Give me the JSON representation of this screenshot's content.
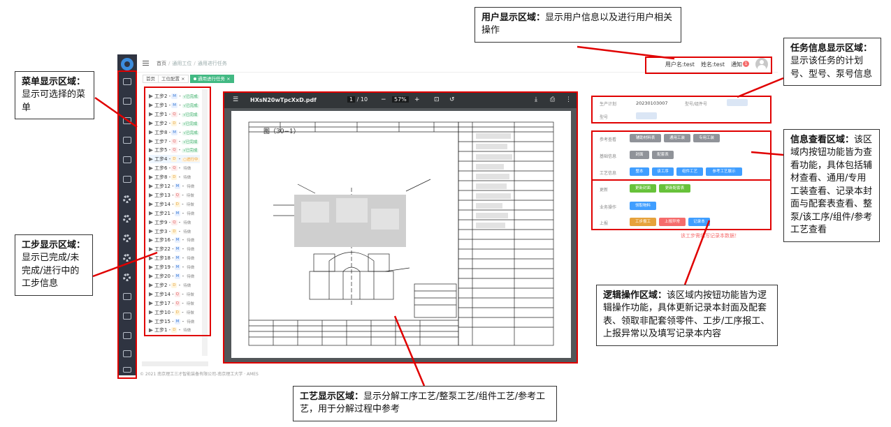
{
  "app": {
    "breadcrumb": [
      "首页",
      "通用工位",
      "通用进行任务"
    ],
    "user": {
      "username_label": "用户名:test",
      "name_label": "姓名:test",
      "notify_label": "通知",
      "notify_count": "1"
    },
    "tabs": [
      {
        "label": "首页"
      },
      {
        "label": "工位配置 ×"
      },
      {
        "label": "通用进行任务 ×",
        "active": true
      }
    ],
    "steps": [
      {
        "name": "工步2 -",
        "tag": "M",
        "status": "√已完成"
      },
      {
        "name": "工步1 -",
        "tag": "M",
        "status": "√已完成"
      },
      {
        "name": "工步1 -",
        "tag": "Q",
        "status": "√已完成"
      },
      {
        "name": "工步2 -",
        "tag": "D",
        "status": "√已完成"
      },
      {
        "name": "工步8 -",
        "tag": "M",
        "status": "√已完成"
      },
      {
        "name": "工步7 -",
        "tag": "Q",
        "status": "√已完成"
      },
      {
        "name": "工步5 -",
        "tag": "Q",
        "status": "√已完成"
      },
      {
        "name": "工步4 -",
        "tag": "D",
        "status": "○进行中"
      },
      {
        "name": "工步6 -",
        "tag": "Q",
        "status": "待做"
      },
      {
        "name": "工步8 -",
        "tag": "D",
        "status": "待做"
      },
      {
        "name": "工步12 -",
        "tag": "M",
        "status": "待做"
      },
      {
        "name": "工步13 -",
        "tag": "Q",
        "status": "待做"
      },
      {
        "name": "工步14 -",
        "tag": "D",
        "status": "待做"
      },
      {
        "name": "工步21 -",
        "tag": "M",
        "status": "待做"
      },
      {
        "name": "工步9 -",
        "tag": "Q",
        "status": "待做"
      },
      {
        "name": "工步3 -",
        "tag": "D",
        "status": "待做"
      },
      {
        "name": "工步16 -",
        "tag": "M",
        "status": "待做"
      },
      {
        "name": "工步22 -",
        "tag": "M",
        "status": "待做"
      },
      {
        "name": "工步18 -",
        "tag": "M",
        "status": "待做"
      },
      {
        "name": "工步19 -",
        "tag": "M",
        "status": "待做"
      },
      {
        "name": "工步20 -",
        "tag": "M",
        "status": "待做"
      },
      {
        "name": "工步2 -",
        "tag": "D",
        "status": "待做"
      },
      {
        "name": "工步14 -",
        "tag": "Q",
        "status": "待做"
      },
      {
        "name": "工步17 -",
        "tag": "Q",
        "status": "待做"
      },
      {
        "name": "工步10 -",
        "tag": "D",
        "status": "待做"
      },
      {
        "name": "工步15 -",
        "tag": "M",
        "status": "待做"
      },
      {
        "name": "工步1 -",
        "tag": "D",
        "status": "待做"
      }
    ],
    "pdf": {
      "filename": "HXsN20wTpcXxD.pdf",
      "page_current": "1",
      "page_total": "/ 10",
      "zoom": "57%",
      "figure_label": "图（30−1）"
    },
    "task_info": {
      "plan_label": "生产计划",
      "plan_value": "20230103007",
      "type_label": "型号/组件号",
      "model_label": "型号"
    },
    "info_view": {
      "rows": [
        {
          "label": "参考查看",
          "buttons": [
            "辅助材料表",
            "通用工装",
            "专用工装"
          ]
        },
        {
          "label": "基础信息",
          "buttons": [
            "封面",
            "配套表"
          ]
        },
        {
          "label": "工艺信息",
          "buttons": [
            "整本",
            "该工序",
            "组件工艺",
            "参考工艺展示"
          ]
        }
      ]
    },
    "logic_ops": {
      "rows": [
        {
          "label": "更新",
          "buttons": [
            "更新封面",
            "更新配套表"
          ]
        },
        {
          "label": "业务操作",
          "buttons": [
            "领取物料"
          ]
        },
        {
          "label": "上报",
          "buttons": [
            "工步报工",
            "上报异常",
            "记录本"
          ]
        }
      ],
      "warning": "该工步需填写记录本数据！"
    },
    "footer": "© 2021 南京理工三才智能装备有限公司-南京理工大学 · AMES"
  },
  "callouts": {
    "user_area": {
      "title": "用户显示区域：",
      "text": "显示用户信息以及进行用户相关操作"
    },
    "task_area": {
      "title": "任务信息显示区域：",
      "text": "显示该任务的计划号、型号、泵号信息"
    },
    "menu_area": {
      "title": "菜单显示区域：",
      "text": "显示可选择的菜单"
    },
    "info_area": {
      "title": "信息查看区域：",
      "text": "该区域内按钮功能皆为查看功能，具体包括辅材查看、通用/专用工装查看、记录本封面与配套表查看、整泵/该工序/组件/参考工艺查看"
    },
    "step_area": {
      "title": "工步显示区域：",
      "text": "显示已完成/未完成/进行中的工步信息"
    },
    "logic_area": {
      "title": "逻辑操作区域：",
      "text": "该区域内按钮功能皆为逻辑操作功能，具体更新记录本封面及配套表、领取非配套领零件、工步/工序报工、上报异常以及填写记录本内容"
    },
    "process_area": {
      "title": "工艺显示区域：",
      "text": "显示分解工序工艺/整泵工艺/组件工艺/参考工艺，用于分解过程中参考"
    }
  }
}
